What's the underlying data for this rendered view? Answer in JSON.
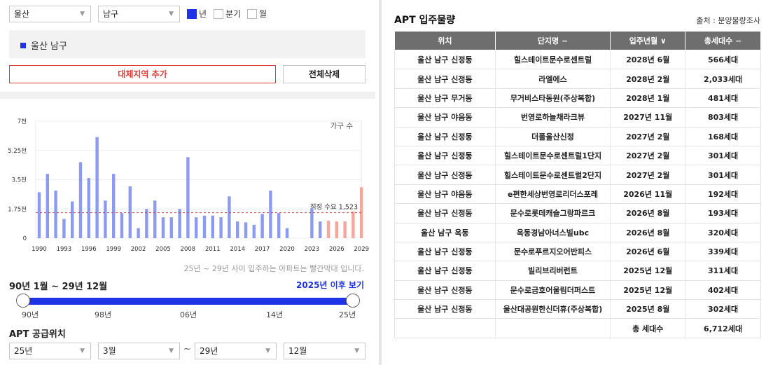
{
  "filters": {
    "city": "울산",
    "district": "남구",
    "period_options": [
      {
        "label": "년",
        "checked": true
      },
      {
        "label": "분기",
        "checked": false
      },
      {
        "label": "월",
        "checked": false
      }
    ]
  },
  "region_list": [
    "울산 남구"
  ],
  "buttons": {
    "add_region": "대체지역 추가",
    "delete_all": "전체삭제"
  },
  "chart_data": {
    "type": "bar",
    "ylabel": "가구 수",
    "y_ticks": [
      "0",
      "1.75천",
      "3.5천",
      "5.25천",
      "7천"
    ],
    "ylim": [
      0,
      7000
    ],
    "x_tick_labels": [
      "1990",
      "1993",
      "1996",
      "1999",
      "2002",
      "2005",
      "2008",
      "2011",
      "2014",
      "2017",
      "2020",
      "2023",
      "2026",
      "2029"
    ],
    "categories": [
      1990,
      1991,
      1992,
      1993,
      1994,
      1995,
      1996,
      1997,
      1998,
      1999,
      2000,
      2001,
      2002,
      2003,
      2004,
      2005,
      2006,
      2007,
      2008,
      2009,
      2010,
      2011,
      2012,
      2013,
      2014,
      2015,
      2016,
      2017,
      2018,
      2019,
      2020,
      2021,
      2022,
      2023,
      2024,
      2025,
      2026,
      2027,
      2028,
      2029
    ],
    "values": [
      2750,
      3850,
      2850,
      1150,
      2200,
      4550,
      3600,
      6050,
      2250,
      3850,
      1500,
      3100,
      600,
      1750,
      2250,
      1250,
      1250,
      1750,
      4850,
      1250,
      1350,
      1350,
      1250,
      2500,
      1000,
      950,
      800,
      1450,
      2850,
      1500,
      600,
      0,
      0,
      1800,
      1000,
      1050,
      1000,
      1000,
      1600,
      3050
    ],
    "projection_start": 2025,
    "reference_line": {
      "label": "적정 수요",
      "value": 1523,
      "display": "1,523"
    },
    "colors": {
      "past": "#8c9af2",
      "future": "#f4a79a",
      "ref_line": "#e53935"
    },
    "grid": true
  },
  "chart_note": "25년 ~ 29년 사이 입주하는 아파트는 빨간막대 입니다.",
  "range": {
    "title": "90년 1월 ~ 29년 12월",
    "link": "2025년 이후 보기",
    "labels": [
      "90년",
      "98년",
      "06년",
      "14년",
      "25년"
    ]
  },
  "supply": {
    "title": "APT 공급위치",
    "from_year": "25년",
    "from_month": "3월",
    "tilde": "~",
    "to_year": "29년",
    "to_month": "12월"
  },
  "apt": {
    "title": "APT 입주물량",
    "source": "출처 : 분양물량조사",
    "headers": [
      "위치",
      "단지명 −",
      "입주년월 ∨",
      "총세대수 −"
    ],
    "rows": [
      [
        "울산 남구 신정동",
        "힐스테이트문수로센트럴",
        "2028년 6월",
        "566세대"
      ],
      [
        "울산 남구 신정동",
        "라엘에스",
        "2028년 2월",
        "2,033세대"
      ],
      [
        "울산 남구 무거동",
        "무거비스타동원(주상복합)",
        "2028년 1월",
        "481세대"
      ],
      [
        "울산 남구 야음동",
        "번영로하늘채라크뷰",
        "2027년 11월",
        "803세대"
      ],
      [
        "울산 남구 신정동",
        "더폴울산신정",
        "2027년 2월",
        "168세대"
      ],
      [
        "울산 남구 신정동",
        "힐스테이트문수로센트럴1단지",
        "2027년 2월",
        "301세대"
      ],
      [
        "울산 남구 신정동",
        "힐스테이트문수로센트럴2단지",
        "2027년 2월",
        "301세대"
      ],
      [
        "울산 남구 야음동",
        "e편한세상번영로리더스포레",
        "2026년 11월",
        "192세대"
      ],
      [
        "울산 남구 신정동",
        "문수로롯데캐슬그랑파르크",
        "2026년 8월",
        "193세대"
      ],
      [
        "울산 남구 옥동",
        "옥동경남아너스빌ubc",
        "2026년 8월",
        "320세대"
      ],
      [
        "울산 남구 신정동",
        "문수로푸르지오어반피스",
        "2026년 6월",
        "339세대"
      ],
      [
        "울산 남구 신정동",
        "빌리브리버런트",
        "2025년 12월",
        "311세대"
      ],
      [
        "울산 남구 신정동",
        "문수로금호어울림더퍼스트",
        "2025년 12월",
        "402세대"
      ],
      [
        "울산 남구 신정동",
        "울산대공원한신더휴(주상복합)",
        "2025년 8월",
        "302세대"
      ]
    ],
    "total_label": "총 세대수",
    "total_value": "6,712세대"
  }
}
